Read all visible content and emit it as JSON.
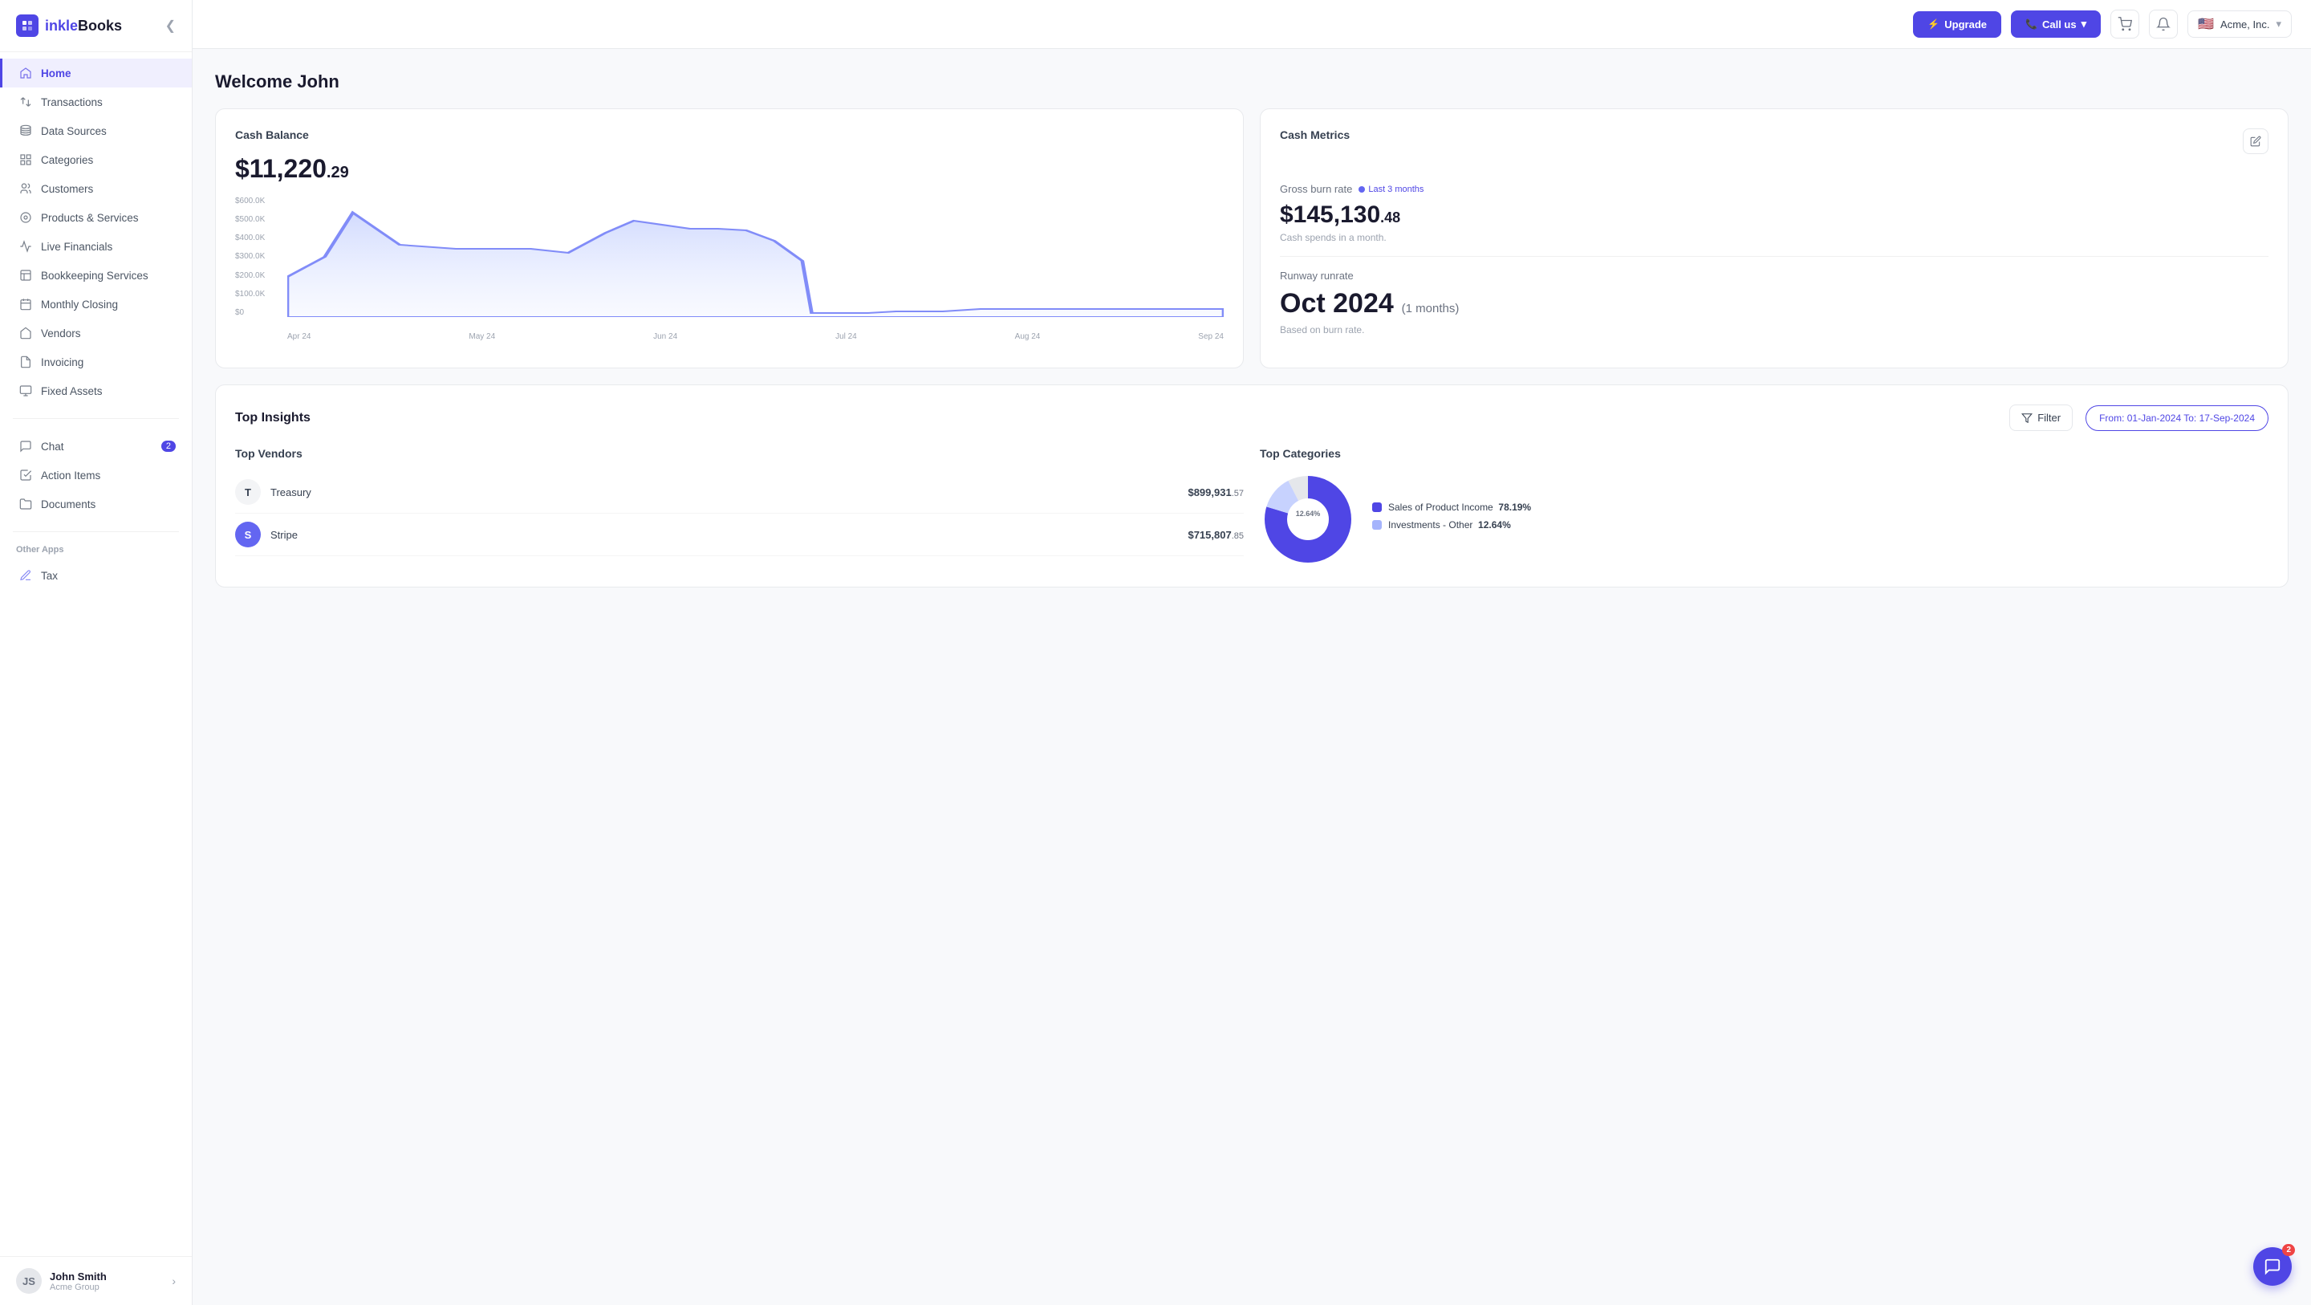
{
  "app": {
    "logo_icon": "M",
    "logo_name_part1": "inkle",
    "logo_name_part2": "Books"
  },
  "topbar": {
    "upgrade_label": "Upgrade",
    "call_label": "Call us",
    "company_name": "Acme, Inc.",
    "collapse_icon": "❮"
  },
  "sidebar": {
    "items": [
      {
        "id": "home",
        "label": "Home",
        "icon": "🏠",
        "active": true
      },
      {
        "id": "transactions",
        "label": "Transactions",
        "icon": "↔"
      },
      {
        "id": "data-sources",
        "label": "Data Sources",
        "icon": "🗂"
      },
      {
        "id": "categories",
        "label": "Categories",
        "icon": "⊞"
      },
      {
        "id": "customers",
        "label": "Customers",
        "icon": "👥"
      },
      {
        "id": "products-services",
        "label": "Products & Services",
        "icon": "⊙"
      },
      {
        "id": "live-financials",
        "label": "Live Financials",
        "icon": "📊"
      },
      {
        "id": "bookkeeping-services",
        "label": "Bookkeeping Services",
        "icon": "📋"
      },
      {
        "id": "monthly-closing",
        "label": "Monthly Closing",
        "icon": "📅"
      },
      {
        "id": "vendors",
        "label": "Vendors",
        "icon": "🏪"
      },
      {
        "id": "invoicing",
        "label": "Invoicing",
        "icon": "🧾"
      },
      {
        "id": "fixed-assets",
        "label": "Fixed Assets",
        "icon": "🖥"
      }
    ],
    "bottom_items": [
      {
        "id": "chat",
        "label": "Chat",
        "icon": "💬",
        "badge": "2"
      },
      {
        "id": "action-items",
        "label": "Action Items",
        "icon": "☑"
      },
      {
        "id": "documents",
        "label": "Documents",
        "icon": "📁"
      }
    ],
    "other_apps_label": "Other Apps",
    "tax_label": "Tax",
    "tax_icon": "✏",
    "user": {
      "name": "John Smith",
      "company": "Acme Group",
      "initials": "JS"
    }
  },
  "main": {
    "welcome": "Welcome John",
    "cash_balance": {
      "title": "Cash Balance",
      "amount_whole": "$11,220",
      "amount_cents": ".29",
      "chart_y_labels": [
        "$600.0K",
        "$500.0K",
        "$400.0K",
        "$300.0K",
        "$200.0K",
        "$100.0K",
        "$0"
      ],
      "chart_x_labels": [
        "Apr 24",
        "May 24",
        "Jun 24",
        "Jul 24",
        "Aug 24",
        "Sep 24"
      ]
    },
    "cash_metrics": {
      "title": "Cash Metrics",
      "gross_burn_rate_label": "Gross burn rate",
      "period_label": "Last 3 months",
      "amount_whole": "$145,130",
      "amount_cents": ".48",
      "cash_spends_desc": "Cash spends in a month.",
      "runway_label": "Runway runrate",
      "runway_value": "Oct 2024",
      "runway_months": "(1 months)",
      "runway_desc": "Based on burn rate."
    },
    "top_insights": {
      "title": "Top Insights",
      "filter_label": "Filter",
      "date_range_label": "From: 01-Jan-2024 To: 17-Sep-2024",
      "top_vendors": {
        "title": "Top Vendors",
        "items": [
          {
            "name": "Treasury",
            "initials": "T",
            "amount_whole": "$899,931",
            "amount_cents": ".57",
            "color": "light"
          },
          {
            "name": "Stripe",
            "initials": "S",
            "amount_whole": "$715,807",
            "amount_cents": ".85",
            "color": "purple"
          }
        ]
      },
      "top_categories": {
        "title": "Top Categories",
        "donut_segments": [
          {
            "label": "Sales of Product Income",
            "percent": "78.19%",
            "color": "#4f46e5"
          },
          {
            "label": "Investments - Other",
            "percent": "12.64%",
            "color": "#a5b4fc"
          }
        ],
        "center_label": "12.64%"
      }
    }
  },
  "chat": {
    "badge": "2",
    "icon": "💬"
  }
}
